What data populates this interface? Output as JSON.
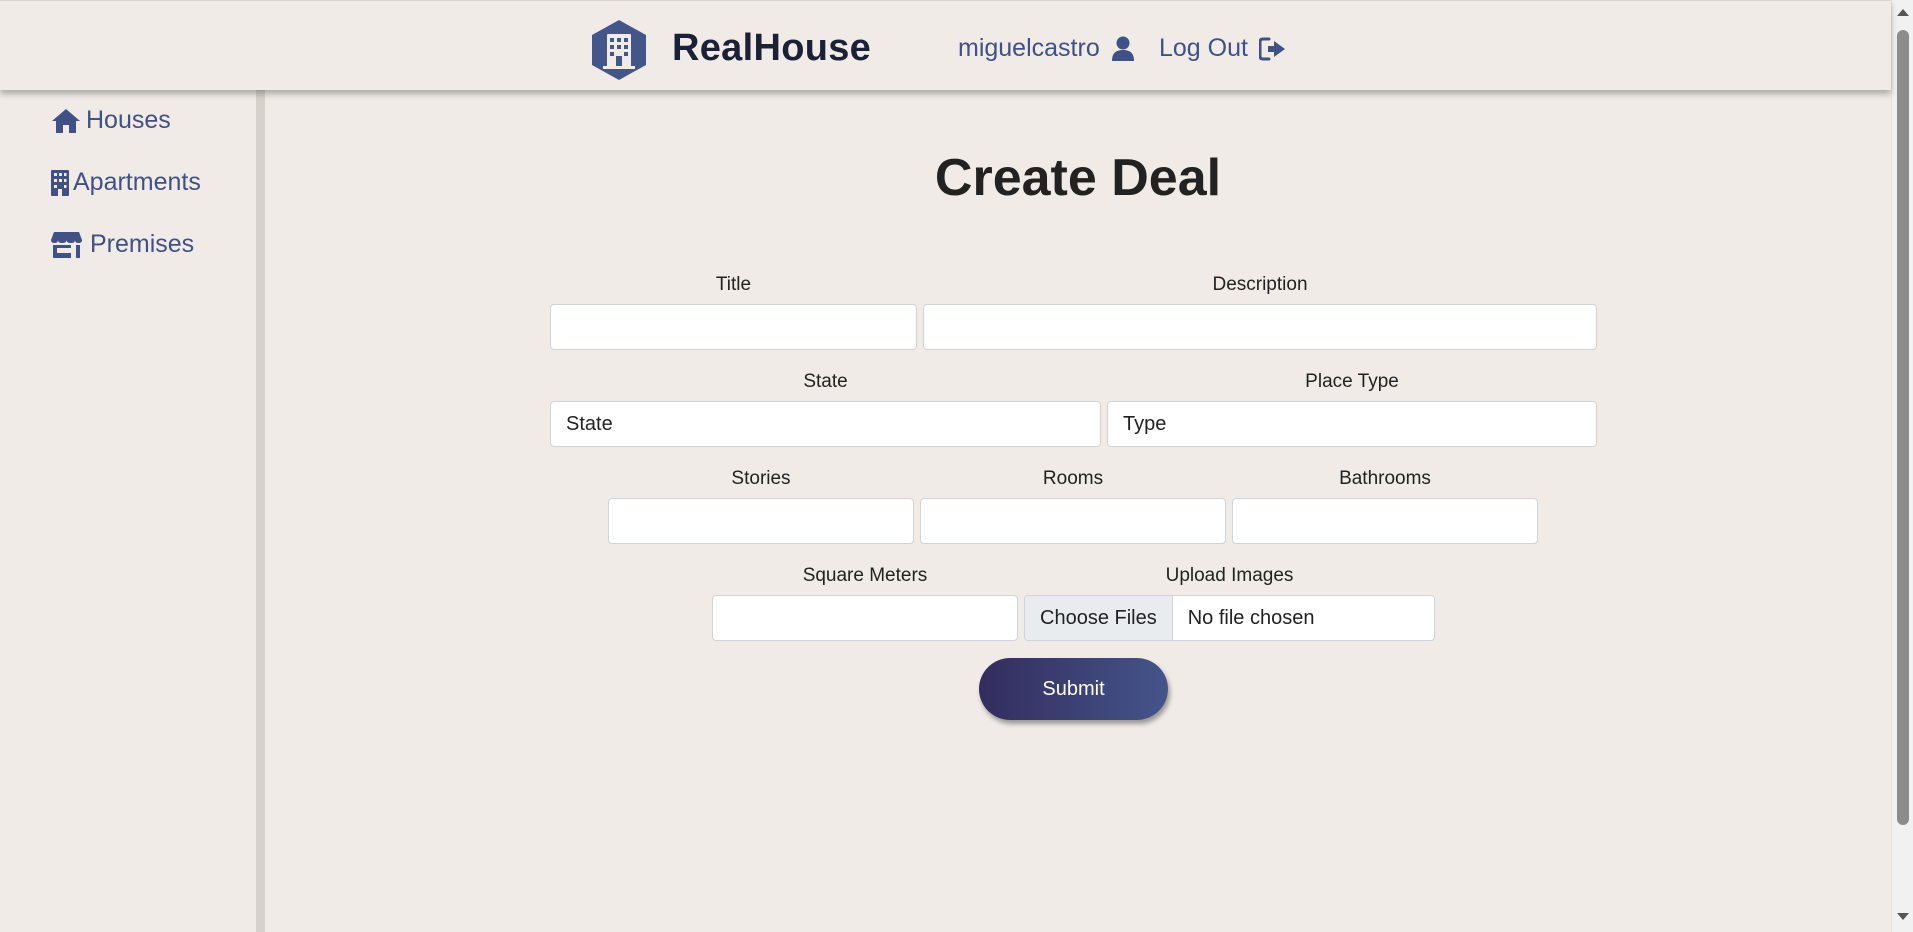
{
  "header": {
    "brand": "RealHouse",
    "username": "miguelcastro",
    "logout_label": "Log Out"
  },
  "sidebar": {
    "items": [
      {
        "label": "Houses",
        "icon": "home-icon"
      },
      {
        "label": "Apartments",
        "icon": "building-icon"
      },
      {
        "label": "Premises",
        "icon": "store-icon"
      }
    ]
  },
  "main": {
    "title": "Create Deal",
    "form": {
      "title_label": "Title",
      "title_value": "",
      "description_label": "Description",
      "description_value": "",
      "state_label": "State",
      "state_selected": "State",
      "place_type_label": "Place Type",
      "place_type_selected": "Type",
      "stories_label": "Stories",
      "stories_value": "",
      "rooms_label": "Rooms",
      "rooms_value": "",
      "bathrooms_label": "Bathrooms",
      "bathrooms_value": "",
      "square_meters_label": "Square Meters",
      "square_meters_value": "",
      "upload_label": "Upload Images",
      "choose_files_label": "Choose Files",
      "file_status": "No file chosen",
      "submit_label": "Submit"
    }
  },
  "colors": {
    "background": "#f0ebe6",
    "accent": "#3f5185",
    "brand_text": "#1b2036",
    "submit_gradient_start": "#342c5e",
    "submit_gradient_end": "#44558a"
  }
}
